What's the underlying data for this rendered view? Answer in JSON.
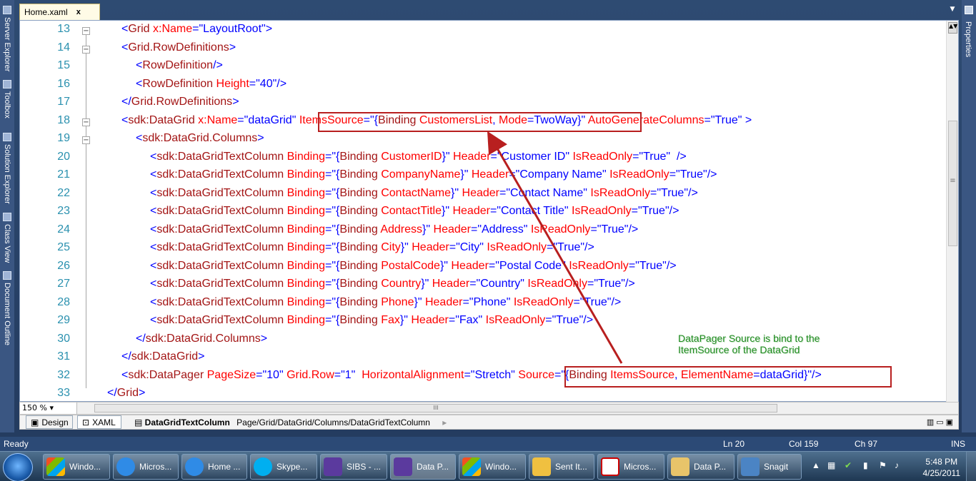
{
  "doc_tab": {
    "title": "Home.xaml",
    "close": "x"
  },
  "left_tools": [
    "Server Explorer",
    "Toolbox",
    "Solution Explorer",
    "Class View",
    "Document Outline"
  ],
  "right_tools": [
    "Properties"
  ],
  "line_numbers": [
    "13",
    "14",
    "15",
    "16",
    "17",
    "18",
    "19",
    "20",
    "21",
    "22",
    "23",
    "24",
    "25",
    "26",
    "27",
    "28",
    "29",
    "30",
    "31",
    "32",
    "33"
  ],
  "annotation": {
    "text": "DataPager Source is bind to the ItemSource of the DataGrid"
  },
  "editor": {
    "zoom": "150 %",
    "hscroll_grip": "III",
    "vscroll_grip": "≡"
  },
  "view_tabs": {
    "design": "Design",
    "xaml": "XAML"
  },
  "breadcrumb": {
    "current": "DataGridTextColumn",
    "path": "Page/Grid/DataGrid/Columns/DataGridTextColumn"
  },
  "status": {
    "ready": "Ready",
    "ln": "Ln 20",
    "col": "Col 159",
    "ch": "Ch 97",
    "ins": "INS"
  },
  "taskbar": {
    "buttons": [
      "Windo...",
      "Micros...",
      "Home ...",
      "Skype...",
      "SIBS - ...",
      "Data P...",
      "Windo...",
      "Sent It...",
      "Micros...",
      "Data P...",
      "Snagit"
    ],
    "time": "5:48 PM",
    "date": "4/25/2011"
  },
  "colors": {
    "tag": "#a31515",
    "attr": "#ff0000",
    "value": "#0000ff",
    "highlight": "#b81f1f",
    "note": "#1f8a1f",
    "arrow": "#b81f1f"
  }
}
